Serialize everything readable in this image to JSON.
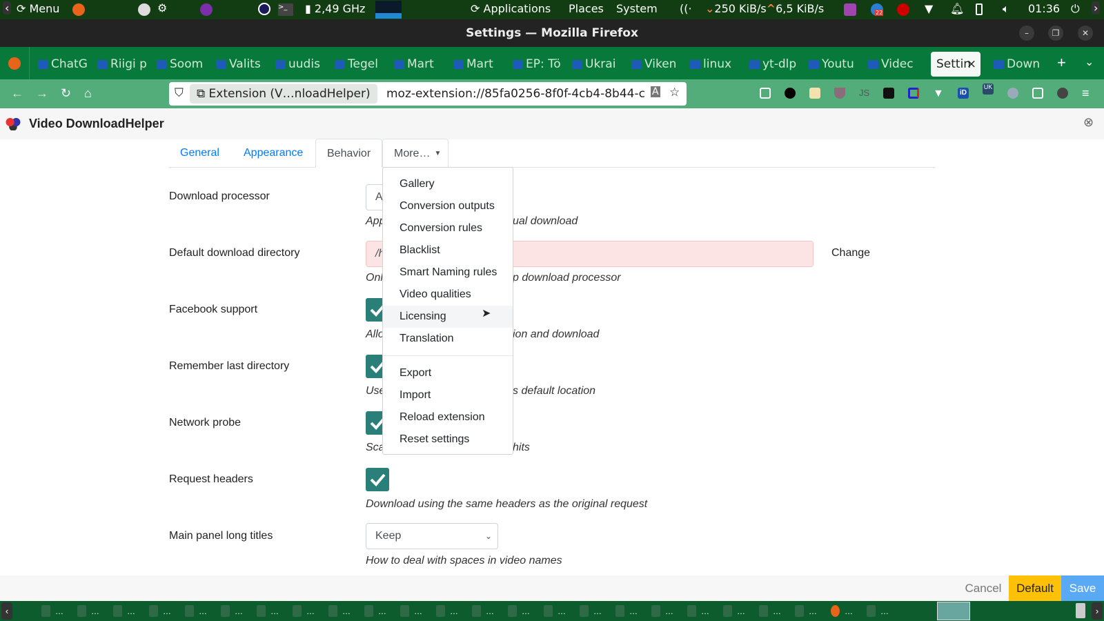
{
  "panel": {
    "menu": "Menu",
    "cpu": "2,49 GHz",
    "places_menu": [
      "Applications",
      "Places",
      "System"
    ],
    "net_down": "250 KiB/s",
    "net_up": "6,5 KiB/s",
    "badge": "22",
    "clock": "01:36"
  },
  "window": {
    "title": "Settings — Mozilla Firefox"
  },
  "browser_tabs": [
    "ChatG",
    "Riigi p",
    "Soom",
    "Valits",
    "uudis",
    "Tegel",
    "Mart",
    "Mart",
    "EP: Tö",
    "Ukrai",
    "Viken",
    "linux",
    "yt-dlp",
    "Youtu",
    "Videc",
    "Settin",
    "Down"
  ],
  "active_tab_index": 15,
  "urlbar": {
    "identity": "Extension (V…nloadHelper)",
    "url": "moz-extension://85fa0256-8f0f-4cb4-8b44-c",
    "ext_badge": "UK"
  },
  "addon": {
    "title": "Video DownloadHelper"
  },
  "tabs": [
    "General",
    "Appearance",
    "Behavior",
    "More…"
  ],
  "settings": [
    {
      "label": "Download processor",
      "value": "A",
      "help": "App",
      "help_tail": "ual download"
    },
    {
      "label": "Default download directory",
      "value": "/h",
      "help": "Onl",
      "help_tail": "p download processor",
      "action": "Change"
    },
    {
      "label": "Facebook support",
      "checked": true,
      "help": "Allo",
      "help_tail": "ion and download"
    },
    {
      "label": "Remember last directory",
      "checked": true,
      "help": "Use",
      "help_tail": "s default location"
    },
    {
      "label": "Network probe",
      "checked": true,
      "help": "Sca",
      "help_tail": "hits"
    },
    {
      "label": "Request headers",
      "checked": true,
      "help": "Download using the same headers as the original request"
    },
    {
      "label": "Main panel long titles",
      "value": "Keep",
      "help": "How to deal with spaces in video names"
    }
  ],
  "more_menu": {
    "group1": [
      "Gallery",
      "Conversion outputs",
      "Conversion rules",
      "Blacklist",
      "Smart Naming rules",
      "Video qualities",
      "Licensing",
      "Translation"
    ],
    "group2": [
      "Export",
      "Import",
      "Reload extension",
      "Reset settings"
    ],
    "hovered": "Licensing"
  },
  "footer": {
    "cancel": "Cancel",
    "default": "Default",
    "save": "Save"
  },
  "taskbar": {
    "ellipsis": "…"
  },
  "colors": {
    "accent": "#007bff",
    "checkbox": "#2a7f78",
    "default_btn": "#ffc107",
    "save_btn": "#5aa9f5",
    "error_field": "#fde4e4"
  }
}
